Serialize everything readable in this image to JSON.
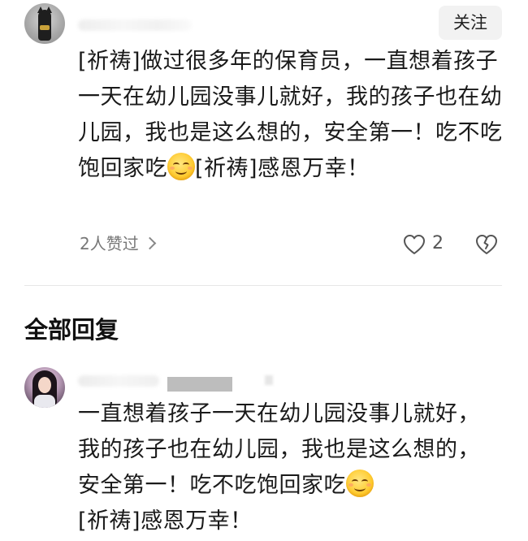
{
  "top_comment": {
    "follow_label": "关注",
    "text_part1": "[祈祷]做过很多年的保育员，一直想着孩子一天在幼儿园没事儿就好，我的孩子也在幼儿园，我也是这么想的，安全第一！吃不吃饱回家吃",
    "text_part2": "[祈祷]感恩万幸！",
    "emoji_name": "smiling-face-emoji",
    "liked_by": "2人赞过",
    "like_count": "2",
    "icons": {
      "like": "heart-outline-icon",
      "dislike": "broken-heart-icon",
      "chevron": "chevron-right-icon"
    }
  },
  "section": {
    "title": "全部回复"
  },
  "reply": {
    "text_part1": "一直想着孩子一天在幼儿园没事儿就好，我的孩子也在幼儿园，我也是这么想的，安全第一！吃不吃饱回家吃",
    "text_part2": "[祈祷]感恩万幸！",
    "emoji_name": "smiling-face-emoji"
  },
  "colors": {
    "text": "#1a1a1a",
    "muted": "#777777",
    "follow_bg": "#f2f2f2",
    "divider": "#e6e6e6"
  }
}
